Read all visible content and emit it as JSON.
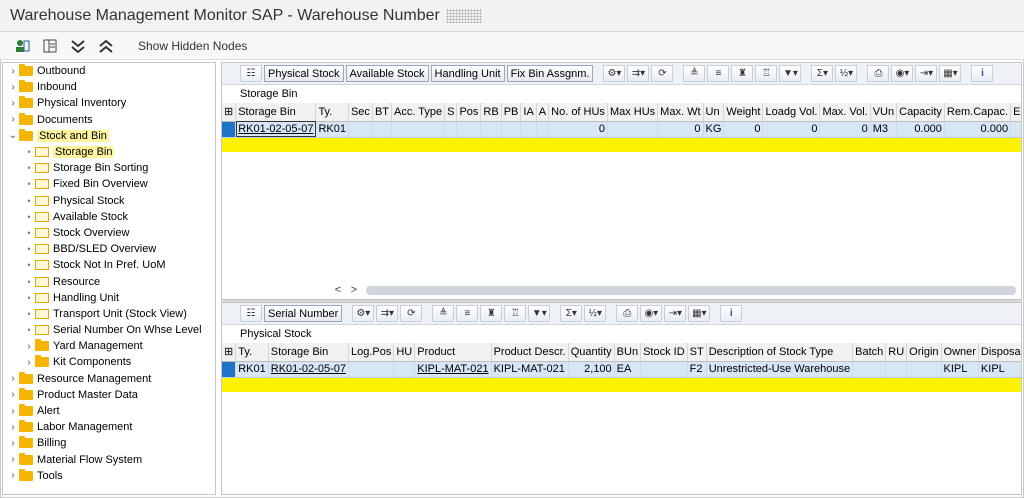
{
  "window": {
    "title": "Warehouse Management Monitor SAP - Warehouse Number"
  },
  "app_toolbar": {
    "icons": [
      "user-config-icon",
      "layout-icon",
      "collapse-all-icon",
      "expand-all-icon"
    ],
    "show_hidden_nodes": "Show Hidden Nodes"
  },
  "tree": {
    "nodes": [
      {
        "label": "Outbound",
        "level": 0,
        "type": "folder"
      },
      {
        "label": "Inbound",
        "level": 0,
        "type": "folder"
      },
      {
        "label": "Physical Inventory",
        "level": 0,
        "type": "folder"
      },
      {
        "label": "Documents",
        "level": 0,
        "type": "folder"
      },
      {
        "label": "Stock and Bin",
        "level": 0,
        "type": "folder-open"
      },
      {
        "label": "Storage Bin",
        "level": 1,
        "type": "node"
      },
      {
        "label": "Storage Bin Sorting",
        "level": 1,
        "type": "node"
      },
      {
        "label": "Fixed Bin Overview",
        "level": 1,
        "type": "node"
      },
      {
        "label": "Physical Stock",
        "level": 1,
        "type": "node"
      },
      {
        "label": "Available Stock",
        "level": 1,
        "type": "node"
      },
      {
        "label": "Stock Overview",
        "level": 1,
        "type": "node"
      },
      {
        "label": "BBD/SLED Overview",
        "level": 1,
        "type": "node"
      },
      {
        "label": "Stock Not In Pref. UoM",
        "level": 1,
        "type": "node"
      },
      {
        "label": "Resource",
        "level": 1,
        "type": "node"
      },
      {
        "label": "Handling Unit",
        "level": 1,
        "type": "node"
      },
      {
        "label": "Transport Unit  (Stock View)",
        "level": 1,
        "type": "node"
      },
      {
        "label": "Serial Number On Whse Level",
        "level": 1,
        "type": "node"
      },
      {
        "label": "Yard Management",
        "level": 1,
        "type": "folder"
      },
      {
        "label": "Kit Components",
        "level": 1,
        "type": "folder"
      },
      {
        "label": "Resource Management",
        "level": 0,
        "type": "folder"
      },
      {
        "label": "Product Master Data",
        "level": 0,
        "type": "folder"
      },
      {
        "label": "Alert",
        "level": 0,
        "type": "folder"
      },
      {
        "label": "Labor Management",
        "level": 0,
        "type": "folder"
      },
      {
        "label": "Billing",
        "level": 0,
        "type": "folder"
      },
      {
        "label": "Material Flow System",
        "level": 0,
        "type": "folder"
      },
      {
        "label": "Tools",
        "level": 0,
        "type": "folder"
      }
    ]
  },
  "top_grid": {
    "buttons": [
      "Physical Stock",
      "Available Stock",
      "Handling Unit",
      "Fix Bin Assgnm."
    ],
    "title": "Storage Bin",
    "columns": [
      "Storage Bin",
      "Ty.",
      "Sec",
      "BT",
      "Acc. Type",
      "S",
      "Pos",
      "RB",
      "PB",
      "IA",
      "A",
      "No. of HUs",
      "Max HUs",
      "Max. Wt",
      "Un",
      "Weight",
      "Loadg Vol.",
      "Max. Vol.",
      "VUn",
      "Capacity",
      "Rem.Capac.",
      "Empty"
    ],
    "rows": [
      [
        "RK01-02-05-07",
        "RK01",
        "",
        "",
        "",
        "",
        "",
        "",
        "",
        "",
        "",
        "0",
        "",
        "0",
        "KG",
        "0",
        "0",
        "0",
        "M3",
        "0.000",
        "0.000",
        ""
      ]
    ]
  },
  "bottom_grid": {
    "buttons": [
      "Serial Number"
    ],
    "title": "Physical Stock",
    "columns": [
      "Ty.",
      "Storage Bin",
      "Log.Pos",
      "HU",
      "Product",
      "Product Descr.",
      "Quantity",
      "BUn",
      "Stock ID",
      "ST",
      "Description of Stock Type",
      "Batch",
      "RU",
      "Origin",
      "Owner",
      "Disposal"
    ],
    "rows": [
      [
        "RK01",
        "RK01-02-05-07",
        "",
        "",
        "KIPL-MAT-021",
        "KIPL-MAT-021",
        "2,100",
        "EA",
        "",
        "F2",
        "Unrestricted-Use Warehouse",
        "",
        "",
        "",
        "KIPL",
        "KIPL"
      ]
    ]
  },
  "scroll": {
    "left": "<",
    "right": ">"
  }
}
